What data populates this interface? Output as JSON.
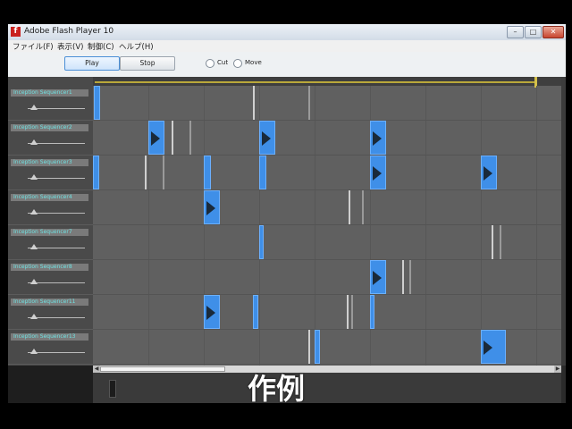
{
  "window": {
    "title": "Adobe Flash Player 10",
    "app_icon": "flash-icon"
  },
  "menu": [
    "ファイル(F)",
    "表示(V)",
    "制御(C)",
    "ヘルプ(H)"
  ],
  "toolbar": {
    "play_label": "Play",
    "stop_label": "Stop",
    "mode_cut_label": "Cut",
    "mode_move_label": "Move"
  },
  "tracks": [
    "Inception Sequencer1",
    "Inception Sequencer2",
    "Inception Sequencer3",
    "Inception Sequencer4",
    "Inception Sequencer7",
    "Inception Sequencer8",
    "Inception Sequencer11",
    "Inception Sequencer13"
  ],
  "caption": "作例",
  "colors": {
    "note": "#3f8fe8",
    "playhead": "#d4c04a",
    "track_label_text": "#6fe0e0"
  }
}
